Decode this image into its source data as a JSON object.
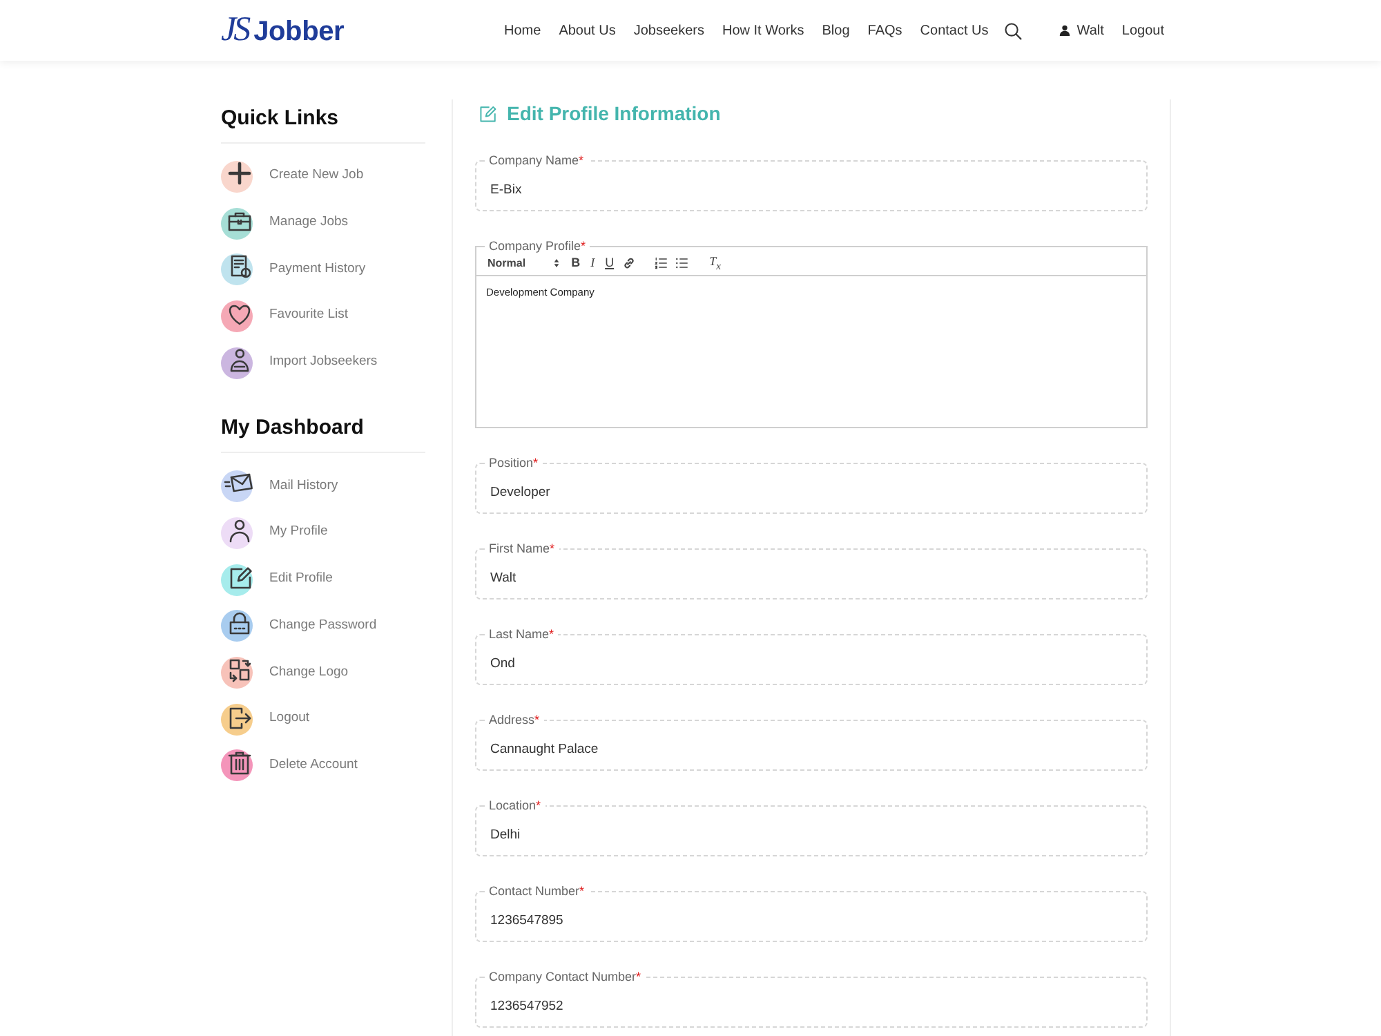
{
  "header": {
    "logo": {
      "mark": "JS",
      "name": "Jobber"
    },
    "nav": [
      "Home",
      "About Us",
      "Jobseekers",
      "How It Works",
      "Blog",
      "FAQs",
      "Contact Us"
    ],
    "user": "Walt",
    "logout": "Logout"
  },
  "sidebar": {
    "sections": [
      {
        "title": "Quick Links",
        "items": [
          "Create New Job",
          "Manage Jobs",
          "Payment History",
          "Favourite List",
          "Import Jobseekers"
        ]
      },
      {
        "title": "My Dashboard",
        "items": [
          "Mail History",
          "My Profile",
          "Edit Profile",
          "Change Password",
          "Change Logo",
          "Logout",
          "Delete Account"
        ]
      }
    ]
  },
  "form": {
    "title": "Edit Profile Information",
    "fields": [
      {
        "kind": "text",
        "label": "Company Name",
        "required_mark": "*",
        "value": "E-Bix"
      },
      {
        "kind": "editor",
        "label": "Company Profile",
        "required_mark": "*",
        "toolbar": {
          "format": "Normal",
          "buttons": [
            {
              "kind": "bold",
              "label": "B"
            },
            {
              "kind": "italic",
              "label": "I"
            },
            {
              "kind": "underline",
              "label": "U"
            },
            {
              "kind": "link"
            },
            {
              "kind": "ordered_list"
            },
            {
              "kind": "bullet_list"
            },
            {
              "kind": "clean",
              "label": "T$_{x}$"
            }
          ]
        },
        "value": "Development Company"
      },
      {
        "kind": "text",
        "label": "Position",
        "required_mark": "*",
        "value": "Developer"
      },
      {
        "kind": "text",
        "label": "First Name",
        "required_mark": "*",
        "value": "Walt"
      },
      {
        "kind": "text",
        "label": "Last Name",
        "required_mark": "*",
        "value": "Ond"
      },
      {
        "kind": "text",
        "label": "Address",
        "required_mark": "*",
        "value": "Cannaught Palace"
      },
      {
        "kind": "text",
        "label": "Location",
        "required_mark": "*",
        "value": "Delhi"
      },
      {
        "kind": "text",
        "label": "Contact Number",
        "required_mark": "*",
        "value": "1236547895"
      },
      {
        "kind": "text",
        "label": "Company Contact Number",
        "required_mark": "*",
        "value": "1236547952"
      }
    ]
  }
}
